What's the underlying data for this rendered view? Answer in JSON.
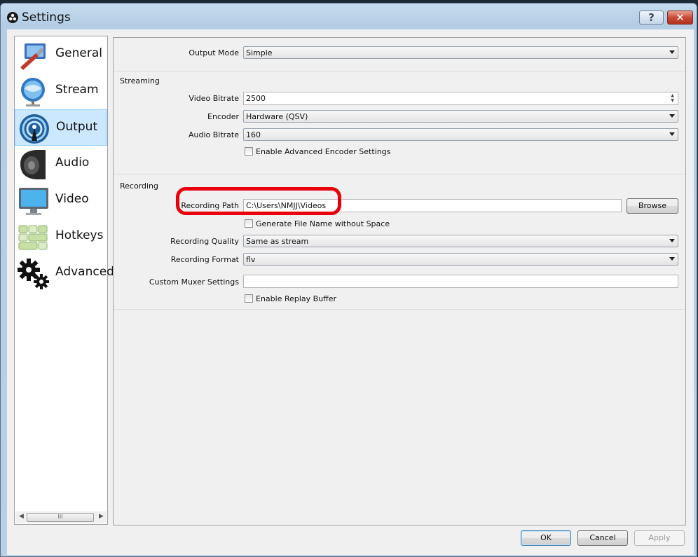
{
  "window": {
    "title": "Settings",
    "help_label": "?",
    "close_label": "✕"
  },
  "sidebar": {
    "items": [
      {
        "label": "General",
        "icon": "general-icon",
        "selected": false
      },
      {
        "label": "Stream",
        "icon": "stream-icon",
        "selected": false
      },
      {
        "label": "Output",
        "icon": "output-icon",
        "selected": true
      },
      {
        "label": "Audio",
        "icon": "audio-icon",
        "selected": false
      },
      {
        "label": "Video",
        "icon": "video-icon",
        "selected": false
      },
      {
        "label": "Hotkeys",
        "icon": "hotkeys-icon",
        "selected": false
      },
      {
        "label": "Advanced",
        "icon": "advanced-icon",
        "selected": false
      }
    ],
    "scroll_thumb": "III"
  },
  "output": {
    "mode_label": "Output Mode",
    "mode_value": "Simple",
    "streaming": {
      "title": "Streaming",
      "video_bitrate_label": "Video Bitrate",
      "video_bitrate_value": "2500",
      "encoder_label": "Encoder",
      "encoder_value": "Hardware (QSV)",
      "audio_bitrate_label": "Audio Bitrate",
      "audio_bitrate_value": "160",
      "advanced_encoder_label": "Enable Advanced Encoder Settings",
      "advanced_encoder_checked": false
    },
    "recording": {
      "title": "Recording",
      "path_label": "Recording Path",
      "path_value": "C:\\Users\\NMJJ\\Videos",
      "browse_label": "Browse",
      "no_space_label": "Generate File Name without Space",
      "no_space_checked": false,
      "quality_label": "Recording Quality",
      "quality_value": "Same as stream",
      "format_label": "Recording Format",
      "format_value": "flv",
      "muxer_label": "Custom Muxer Settings",
      "muxer_value": "",
      "replay_label": "Enable Replay Buffer",
      "replay_checked": false
    }
  },
  "footer": {
    "ok_label": "OK",
    "cancel_label": "Cancel",
    "apply_label": "Apply"
  },
  "colors": {
    "highlight": "#e8000b",
    "selection": "#cce8ff"
  }
}
